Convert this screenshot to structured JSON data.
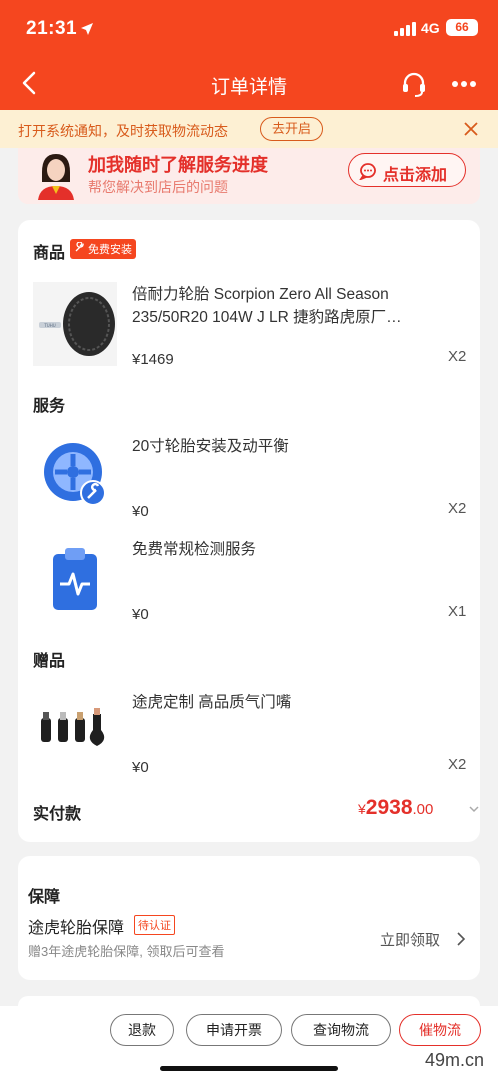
{
  "status_bar": {
    "time": "21:31",
    "network": "4G",
    "battery": "66"
  },
  "nav": {
    "title": "订单详情",
    "back_icon": "chevron-left-icon",
    "service_icon": "headset-icon",
    "more_icon": "more-icon"
  },
  "notice": {
    "text": "打开系统通知，及时获取物流动态",
    "button": "去开启"
  },
  "promo": {
    "title": "加我随时了解服务进度",
    "subtitle": "帮您解决到店后的问题",
    "button": "点击添加"
  },
  "order": {
    "goods_title": "商品",
    "goods_tag": "免费安装",
    "goods": [
      {
        "name": "倍耐力轮胎 Scorpion Zero All Season 235/50R20 104W J LR 捷豹路虎原厂…",
        "price": "¥1469",
        "qty": "X2"
      }
    ],
    "service_title": "服务",
    "services": [
      {
        "name": "20寸轮胎安装及动平衡",
        "price": "¥0",
        "qty": "X2",
        "icon": "wheel-wrench-icon"
      },
      {
        "name": "免费常规检测服务",
        "price": "¥0",
        "qty": "X1",
        "icon": "clipboard-pulse-icon"
      }
    ],
    "gift_title": "赠品",
    "gifts": [
      {
        "name": "途虎定制 高品质气门嘴",
        "price": "¥0",
        "qty": "X2"
      }
    ],
    "total_label": "实付款",
    "total_currency": "¥",
    "total_int": "2938",
    "total_dec": ".00"
  },
  "guarantee": {
    "title": "保障",
    "name": "途虎轮胎保障",
    "badge": "待认证",
    "desc": "赠3年途虎轮胎保障, 领取后可查看",
    "action": "立即领取"
  },
  "bottom_actions": [
    "退款",
    "申请开票",
    "查询物流",
    "催物流"
  ],
  "watermark": "49m.cn",
  "colors": {
    "brand": "#f5461f",
    "price": "#e4302a",
    "notice_bg": "#fdf0d3"
  }
}
